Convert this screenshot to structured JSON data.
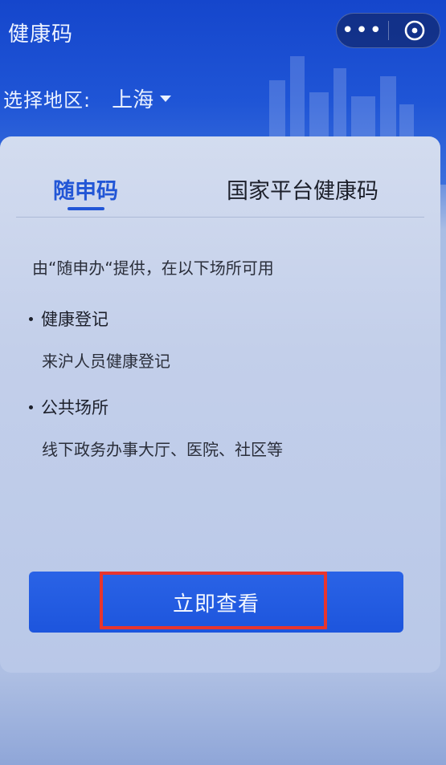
{
  "header": {
    "title": "健康码",
    "region_label": "选择地区:",
    "region_value": "上海"
  },
  "capsule": {
    "more_glyph": "•••"
  },
  "tabs": [
    {
      "label": "随申码",
      "active": true
    },
    {
      "label": "国家平台健康码",
      "active": false
    }
  ],
  "content": {
    "intro": "由“随申办“提供，在以下场所可用",
    "sections": [
      {
        "title": "健康登记",
        "desc": "来沪人员健康登记"
      },
      {
        "title": "公共场所",
        "desc": "线下政务办事大厅、医院、社区等"
      }
    ]
  },
  "actions": {
    "view_label": "立即查看"
  },
  "colors": {
    "accent": "#2256d6",
    "header": "#1a4fd0",
    "button": "#1d55dd",
    "highlight": "#e8352e"
  }
}
